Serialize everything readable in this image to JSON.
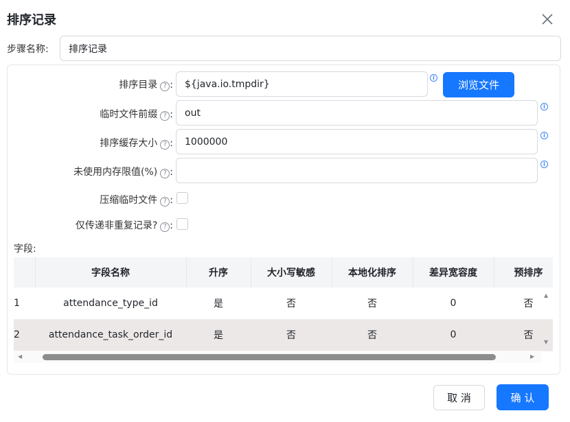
{
  "dialog": {
    "title": "排序记录",
    "step_name_label": "步骤名称:",
    "step_name_value": "排序记录"
  },
  "form": {
    "sort_dir": {
      "label": "排序目录",
      "value": "${java.io.tmpdir}",
      "browse_label": "浏览文件"
    },
    "temp_prefix": {
      "label": "临时文件前缀",
      "value": "out"
    },
    "sort_buffer": {
      "label": "排序缓存大小",
      "value": "1000000"
    },
    "mem_limit": {
      "label": "未使用内存限值(%)",
      "value": ""
    },
    "compress": {
      "label": "压缩临时文件",
      "checked": false
    },
    "unique": {
      "label": "仅传递非重复记录?",
      "checked": false
    },
    "colon": ":",
    "help_glyph": "?",
    "info_glyph": "i"
  },
  "fields_table": {
    "label": "字段:",
    "columns": [
      "",
      "字段名称",
      "升序",
      "大小写敏感",
      "本地化排序",
      "差异宽容度",
      "预排序"
    ],
    "rows": [
      [
        "1",
        "attendance_type_id",
        "是",
        "否",
        "否",
        "0",
        "否"
      ],
      [
        "2",
        "attendance_task_order_id",
        "是",
        "否",
        "否",
        "0",
        "否"
      ]
    ]
  },
  "footer": {
    "cancel_label": "取 消",
    "ok_label": "确 认"
  },
  "colors": {
    "primary": "#1677ff",
    "selected_row": "#ede8e8",
    "header_bg": "#f4f5f7"
  }
}
